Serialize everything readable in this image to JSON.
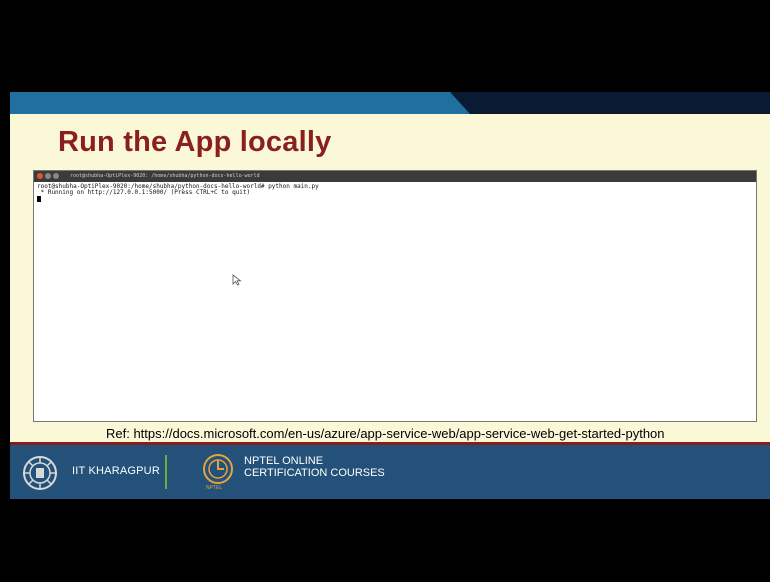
{
  "slide": {
    "title": "Run the App locally",
    "reference": "Ref: https://docs.microsoft.com/en-us/azure/app-service-web/app-service-web-get-started-python"
  },
  "terminal": {
    "window_title": "root@shubha-OptiPlex-9020: /home/shubha/python-docs-hello-world",
    "lines": [
      "root@shubha-OptiPlex-9020:/home/shubha/python-docs-hello-world# python main.py",
      " * Running on http://127.0.0.1:5000/ (Press CTRL+C to quit)"
    ]
  },
  "footer": {
    "institute": "IIT KHARAGPUR",
    "nptel_line1": "NPTEL ONLINE",
    "nptel_line2": "CERTIFICATION COURSES",
    "nptel_small": "NPTEL"
  },
  "colors": {
    "title": "#8a1f1f",
    "slide_background": "#fbf8d8",
    "footer_background": "#23517a",
    "accent_red": "#8a1c1c",
    "divider_green": "#6fae3d"
  },
  "icons": {
    "left_logo": "iit-kharagpur-emblem-icon",
    "right_logo": "nptel-logo-icon",
    "pointer": "mouse-pointer-icon"
  }
}
